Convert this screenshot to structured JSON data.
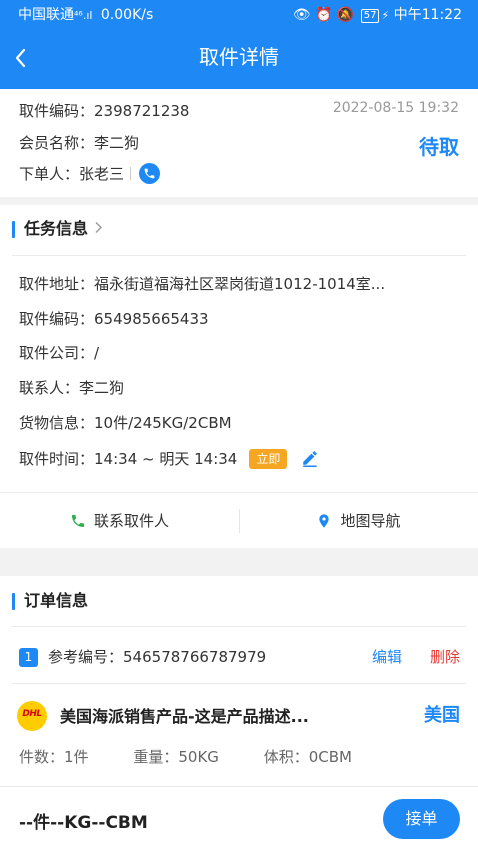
{
  "status_bar": {
    "carrier": "中国联通",
    "network": "⁴⁶.ıl",
    "speed": "0.00K/s",
    "battery": "57",
    "time": "中午11:22"
  },
  "header": {
    "title": "取件详情"
  },
  "summary": {
    "code_label": "取件编码：",
    "code": "2398721238",
    "datetime": "2022-08-15 19:32",
    "member_label": "会员名称：",
    "member": "李二狗",
    "status": "待取",
    "orderer_label": "下单人：",
    "orderer": "张老三"
  },
  "task": {
    "title": "任务信息",
    "address_label": "取件地址：",
    "address": "福永街道福海社区翠岗街道1012-1014室...",
    "code_label": "取件编码：",
    "code": "654985665433",
    "company_label": "取件公司：",
    "company": "/",
    "contact_label": "联系人：",
    "contact": "李二狗",
    "goods_label": "货物信息：",
    "goods": "10件/245KG/2CBM",
    "time_label": "取件时间：",
    "time": "14:34 ~ 明天 14:34",
    "time_badge": "立即"
  },
  "actions": {
    "contact": "联系取件人",
    "navigate": "地图导航"
  },
  "order": {
    "title": "订单信息",
    "index": "1",
    "ref_label": "参考编号：",
    "ref": "546578766787979",
    "edit": "编辑",
    "delete": "删除",
    "carrier_logo_text": "DHL",
    "product": "美国海派销售产品-这是产品描述...",
    "country": "美国",
    "qty_label": "件数：",
    "qty": "1件",
    "weight_label": "重量：",
    "weight": "50KG",
    "volume_label": "体积：",
    "volume": "0CBM"
  },
  "footer": {
    "total": "--件--KG--CBM",
    "accept": "接单"
  },
  "colors": {
    "primary": "#1e88f5",
    "badge": "#f5a623",
    "danger": "#e53935",
    "call_green": "#2db34a"
  }
}
